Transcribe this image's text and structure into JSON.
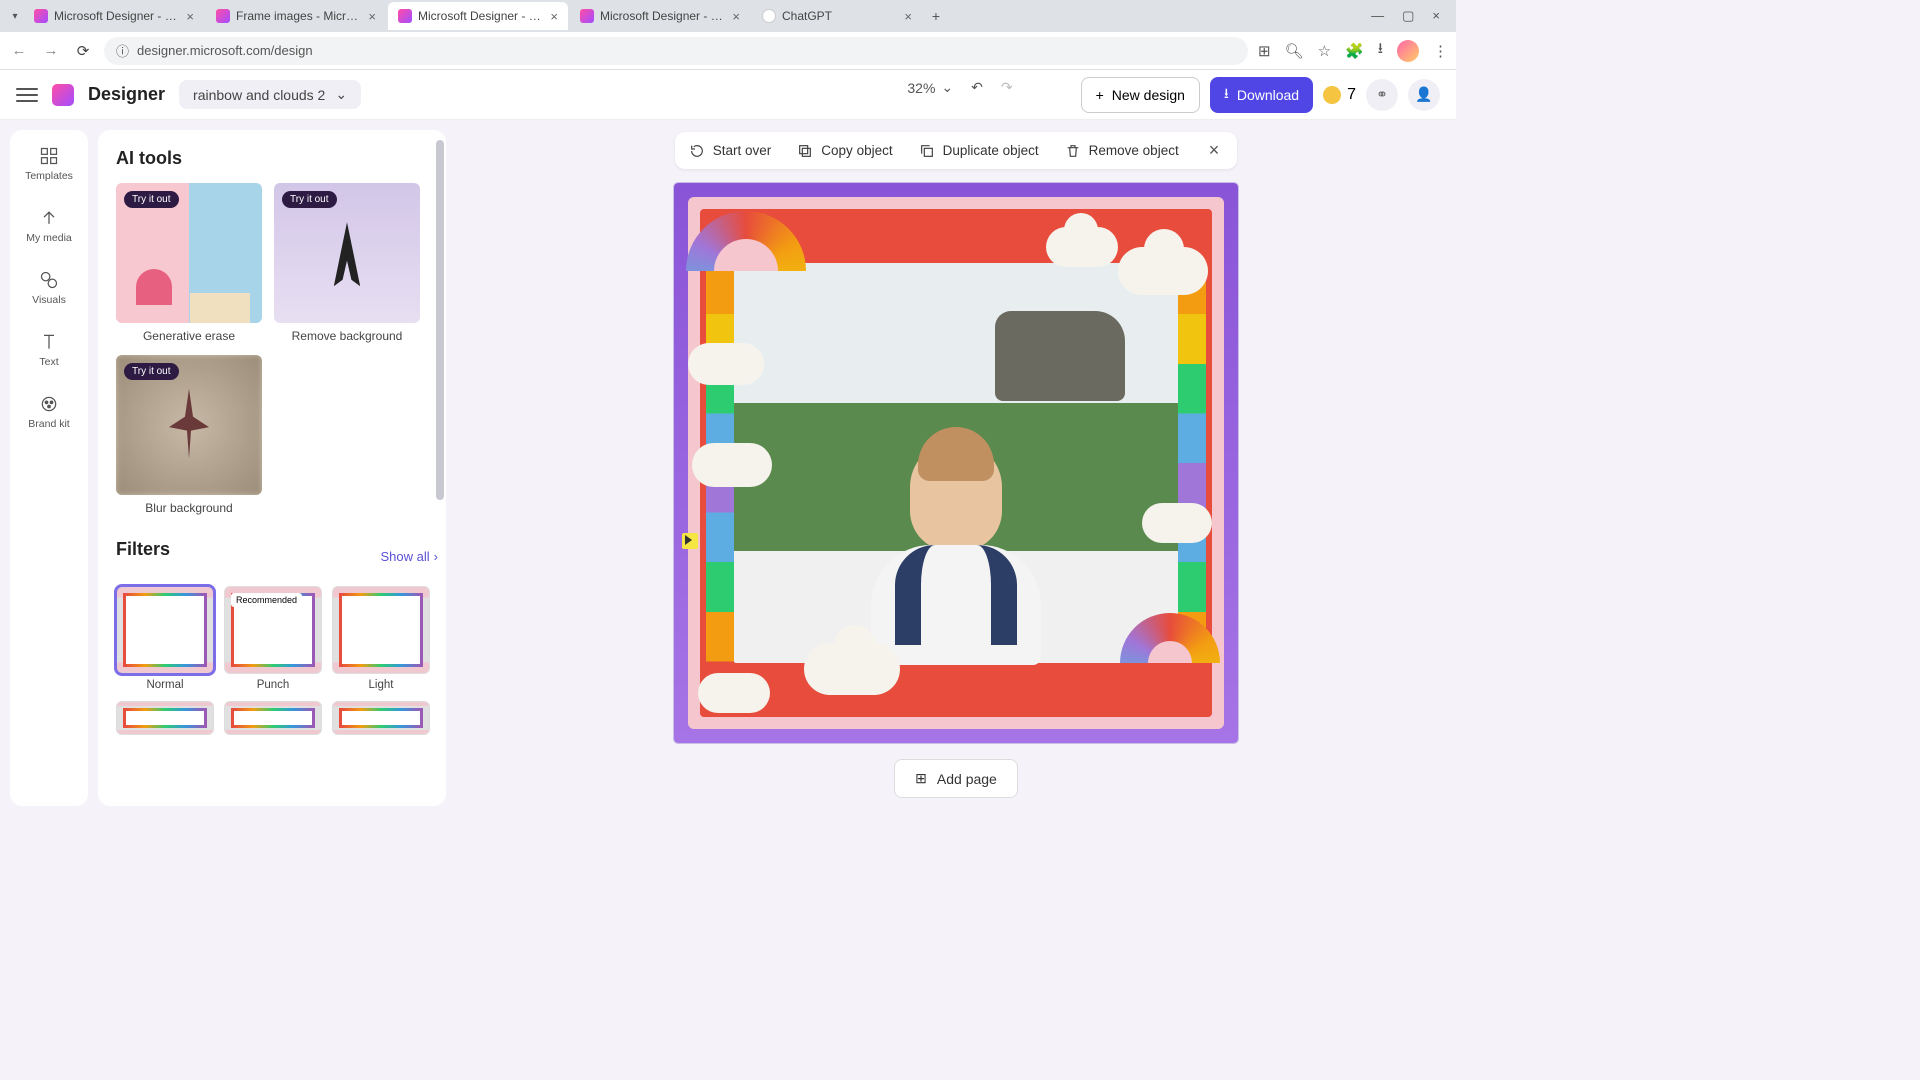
{
  "browser": {
    "tabs": [
      {
        "title": "Microsoft Designer - Stunning",
        "active": false
      },
      {
        "title": "Frame images - Microsoft Des",
        "active": false
      },
      {
        "title": "Microsoft Designer - Stunning",
        "active": true
      },
      {
        "title": "Microsoft Designer - Stunning",
        "active": false
      },
      {
        "title": "ChatGPT",
        "active": false,
        "chat": true
      }
    ],
    "url": "designer.microsoft.com/design"
  },
  "header": {
    "logo_text": "Designer",
    "design_name": "rainbow and clouds 2",
    "zoom": "32%",
    "new_design": "New design",
    "download": "Download",
    "credits": "7"
  },
  "rail": {
    "templates": "Templates",
    "my_media": "My media",
    "visuals": "Visuals",
    "text": "Text",
    "brand_kit": "Brand kit"
  },
  "panel": {
    "ai_tools_title": "AI tools",
    "try_it_out": "Try it out",
    "tools": {
      "gen_erase": "Generative erase",
      "remove_bg": "Remove background",
      "blur_bg": "Blur background"
    },
    "filters_title": "Filters",
    "show_all": "Show all",
    "recommended": "Recommended",
    "filters": {
      "normal": "Normal",
      "punch": "Punch",
      "light": "Light"
    }
  },
  "context_bar": {
    "start_over": "Start over",
    "copy_object": "Copy object",
    "duplicate_object": "Duplicate object",
    "remove_object": "Remove object"
  },
  "canvas_footer": {
    "add_page": "Add page"
  }
}
